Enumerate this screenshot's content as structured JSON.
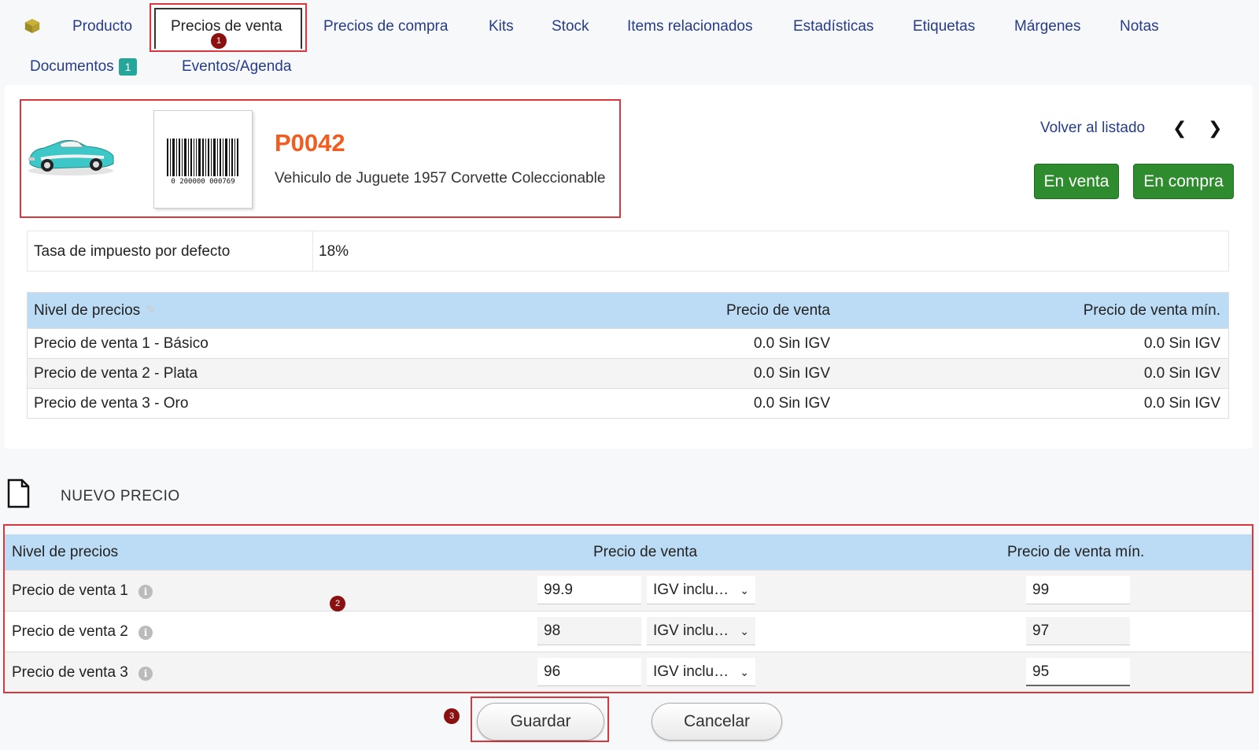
{
  "tabs": {
    "producto": "Producto",
    "precios_venta": "Precios de venta",
    "precios_compra": "Precios de compra",
    "kits": "Kits",
    "stock": "Stock",
    "items_relacionados": "Items relacionados",
    "estadisticas": "Estadísticas",
    "etiquetas": "Etiquetas",
    "margenes": "Márgenes",
    "notas": "Notas",
    "documentos": "Documentos",
    "documentos_count": "1",
    "eventos": "Eventos/Agenda"
  },
  "markers": {
    "m1": "1",
    "m2": "2",
    "m3": "3"
  },
  "product": {
    "sku": "P0042",
    "name": "Vehiculo de Juguete 1957 Corvette Coleccionable",
    "barcode_text": "0 200000 000769",
    "back_link": "Volver al listado",
    "prev_icon": "chevron-left-icon",
    "next_icon": "chevron-right-icon",
    "status_sale": "En venta",
    "status_purchase": "En compra"
  },
  "tax": {
    "label": "Tasa de impuesto por defecto",
    "value": "18%"
  },
  "price_table": {
    "headers": {
      "level": "Nivel de precios",
      "price": "Precio de venta",
      "min_price": "Precio de venta mín."
    },
    "rows": [
      {
        "level": "Precio de venta 1 - Básico",
        "price": "0.0 Sin IGV",
        "min_price": "0.0 Sin IGV"
      },
      {
        "level": "Precio de venta 2 - Plata",
        "price": "0.0 Sin IGV",
        "min_price": "0.0 Sin IGV"
      },
      {
        "level": "Precio de venta 3 - Oro",
        "price": "0.0 Sin IGV",
        "min_price": "0.0 Sin IGV"
      }
    ]
  },
  "new_price": {
    "title": "NUEVO PRECIO",
    "headers": {
      "level": "Nivel de precios",
      "price": "Precio de venta",
      "min_price": "Precio de venta mín."
    },
    "rows": [
      {
        "level": "Precio de venta 1",
        "price": "99.9",
        "tax_mode": "IGV inclu…",
        "min_price": "99"
      },
      {
        "level": "Precio de venta 2",
        "price": "98",
        "tax_mode": "IGV inclu…",
        "min_price": "97"
      },
      {
        "level": "Precio de venta 3",
        "price": "96",
        "tax_mode": "IGV inclu…",
        "min_price": "95"
      }
    ]
  },
  "buttons": {
    "save": "Guardar",
    "cancel": "Cancelar"
  },
  "colors": {
    "accent": "#263c8a",
    "sku": "#f25c1e",
    "green": "#2e8b2e",
    "header_blue": "#bcdcf5",
    "highlight": "#d9363e"
  }
}
